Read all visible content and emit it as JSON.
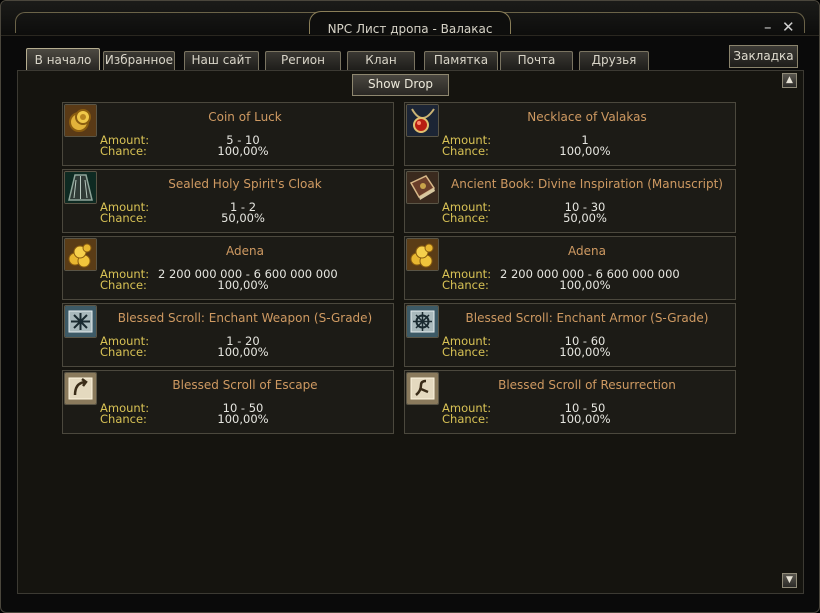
{
  "window": {
    "title": "NPC Лист дропа - Валакас"
  },
  "tabs": [
    {
      "label": "В начало",
      "active": true
    },
    {
      "label": "Избранное"
    },
    {
      "label": "Наш сайт"
    },
    {
      "label": "Регион"
    },
    {
      "label": "Клан"
    },
    {
      "label": "Памятка"
    },
    {
      "label": "Почта"
    },
    {
      "label": "Друзья"
    }
  ],
  "bookmark_label": "Закладка",
  "show_drop_label": "Show Drop",
  "field_labels": {
    "amount": "Amount:",
    "chance": "Chance:"
  },
  "items": [
    {
      "name": "Coin of Luck",
      "amount": "5 - 10",
      "chance": "100,00%",
      "icon": "gold-coin-icon"
    },
    {
      "name": "Necklace of Valakas",
      "amount": "1",
      "chance": "100,00%",
      "icon": "necklace-icon"
    },
    {
      "name": "Sealed Holy Spirit's Cloak",
      "amount": "1 - 2",
      "chance": "50,00%",
      "icon": "cloak-icon"
    },
    {
      "name": "Ancient Book: Divine Inspiration (Manuscript)",
      "amount": "10 - 30",
      "chance": "50,00%",
      "icon": "book-icon"
    },
    {
      "name": "Adena",
      "amount": "2 200 000 000 - 6 600 000 000",
      "chance": "100,00%",
      "icon": "adena-icon"
    },
    {
      "name": "Adena",
      "amount": "2 200 000 000 - 6 600 000 000",
      "chance": "100,00%",
      "icon": "adena-icon"
    },
    {
      "name": "Blessed Scroll: Enchant Weapon (S-Grade)",
      "amount": "1 - 20",
      "chance": "100,00%",
      "icon": "weapon-scroll-icon"
    },
    {
      "name": "Blessed Scroll: Enchant Armor (S-Grade)",
      "amount": "10 - 60",
      "chance": "100,00%",
      "icon": "armor-scroll-icon"
    },
    {
      "name": "Blessed Scroll of Escape",
      "amount": "10 - 50",
      "chance": "100,00%",
      "icon": "escape-scroll-icon"
    },
    {
      "name": "Blessed Scroll of Resurrection",
      "amount": "10 - 50",
      "chance": "100,00%",
      "icon": "resurrection-scroll-icon"
    }
  ]
}
